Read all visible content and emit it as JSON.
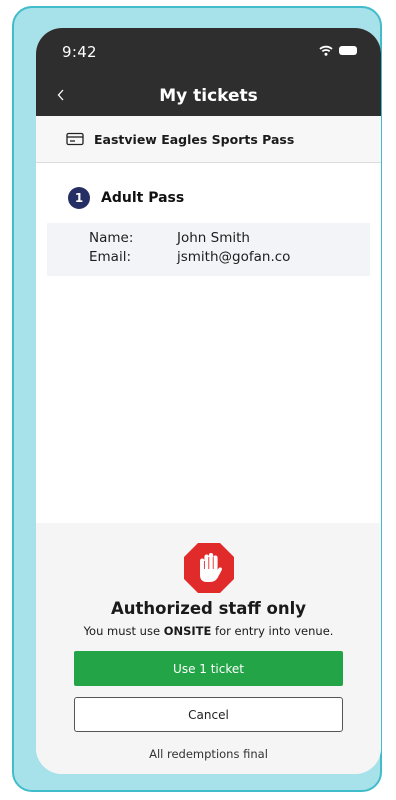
{
  "status_bar": {
    "time": "9:42"
  },
  "header": {
    "title": "My tickets",
    "back_icon": "chevron-left-icon"
  },
  "pass": {
    "name": "Eastview Eagles Sports Pass",
    "icon": "card-icon"
  },
  "ticket": {
    "number": "1",
    "type": "Adult Pass",
    "name_label": "Name:",
    "name_value": "John Smith",
    "email_label": "Email:",
    "email_value": "jsmith@gofan.co"
  },
  "staff": {
    "icon": "stop-hand-icon",
    "title": "Authorized staff only",
    "subtitle_prefix": "You must use ",
    "subtitle_bold": "ONSITE",
    "subtitle_suffix": " for entry into venue.",
    "use_button": "Use 1 ticket",
    "cancel_button": "Cancel",
    "note": "All redemptions final"
  },
  "colors": {
    "frame_bg": "#a7e2ea",
    "frame_border": "#41bccb",
    "header_bg": "#2e2e2e",
    "badge": "#262f63",
    "primary_button": "#23a447",
    "stop_red": "#e12b2b"
  }
}
